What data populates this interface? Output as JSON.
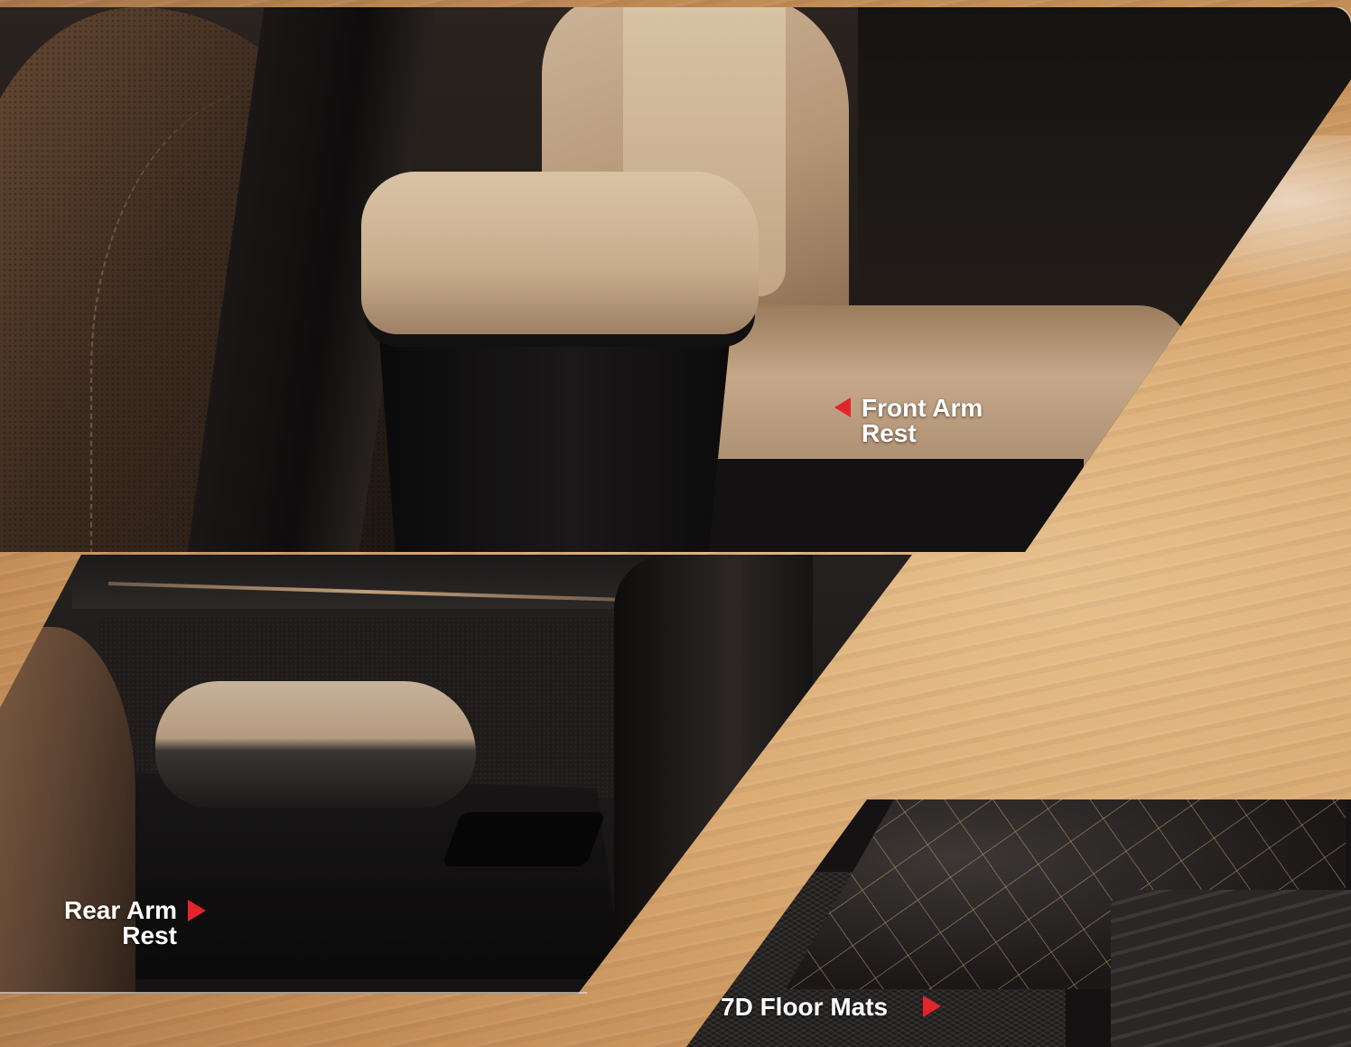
{
  "labels": {
    "front": {
      "line1": "Front Arm",
      "line2": "Rest"
    },
    "rear": {
      "line1": "Rear Arm",
      "line2": "Rest"
    },
    "mats": {
      "text": "7D Floor Mats"
    }
  },
  "icons": {
    "front_arrow": "left-triangle-arrow",
    "rear_arrow": "right-triangle-arrow",
    "mats_arrow": "right-triangle-arrow"
  },
  "colors": {
    "accent_arrow": "#e3242b",
    "label_text": "#ffffff",
    "sand": "#d9a870"
  }
}
